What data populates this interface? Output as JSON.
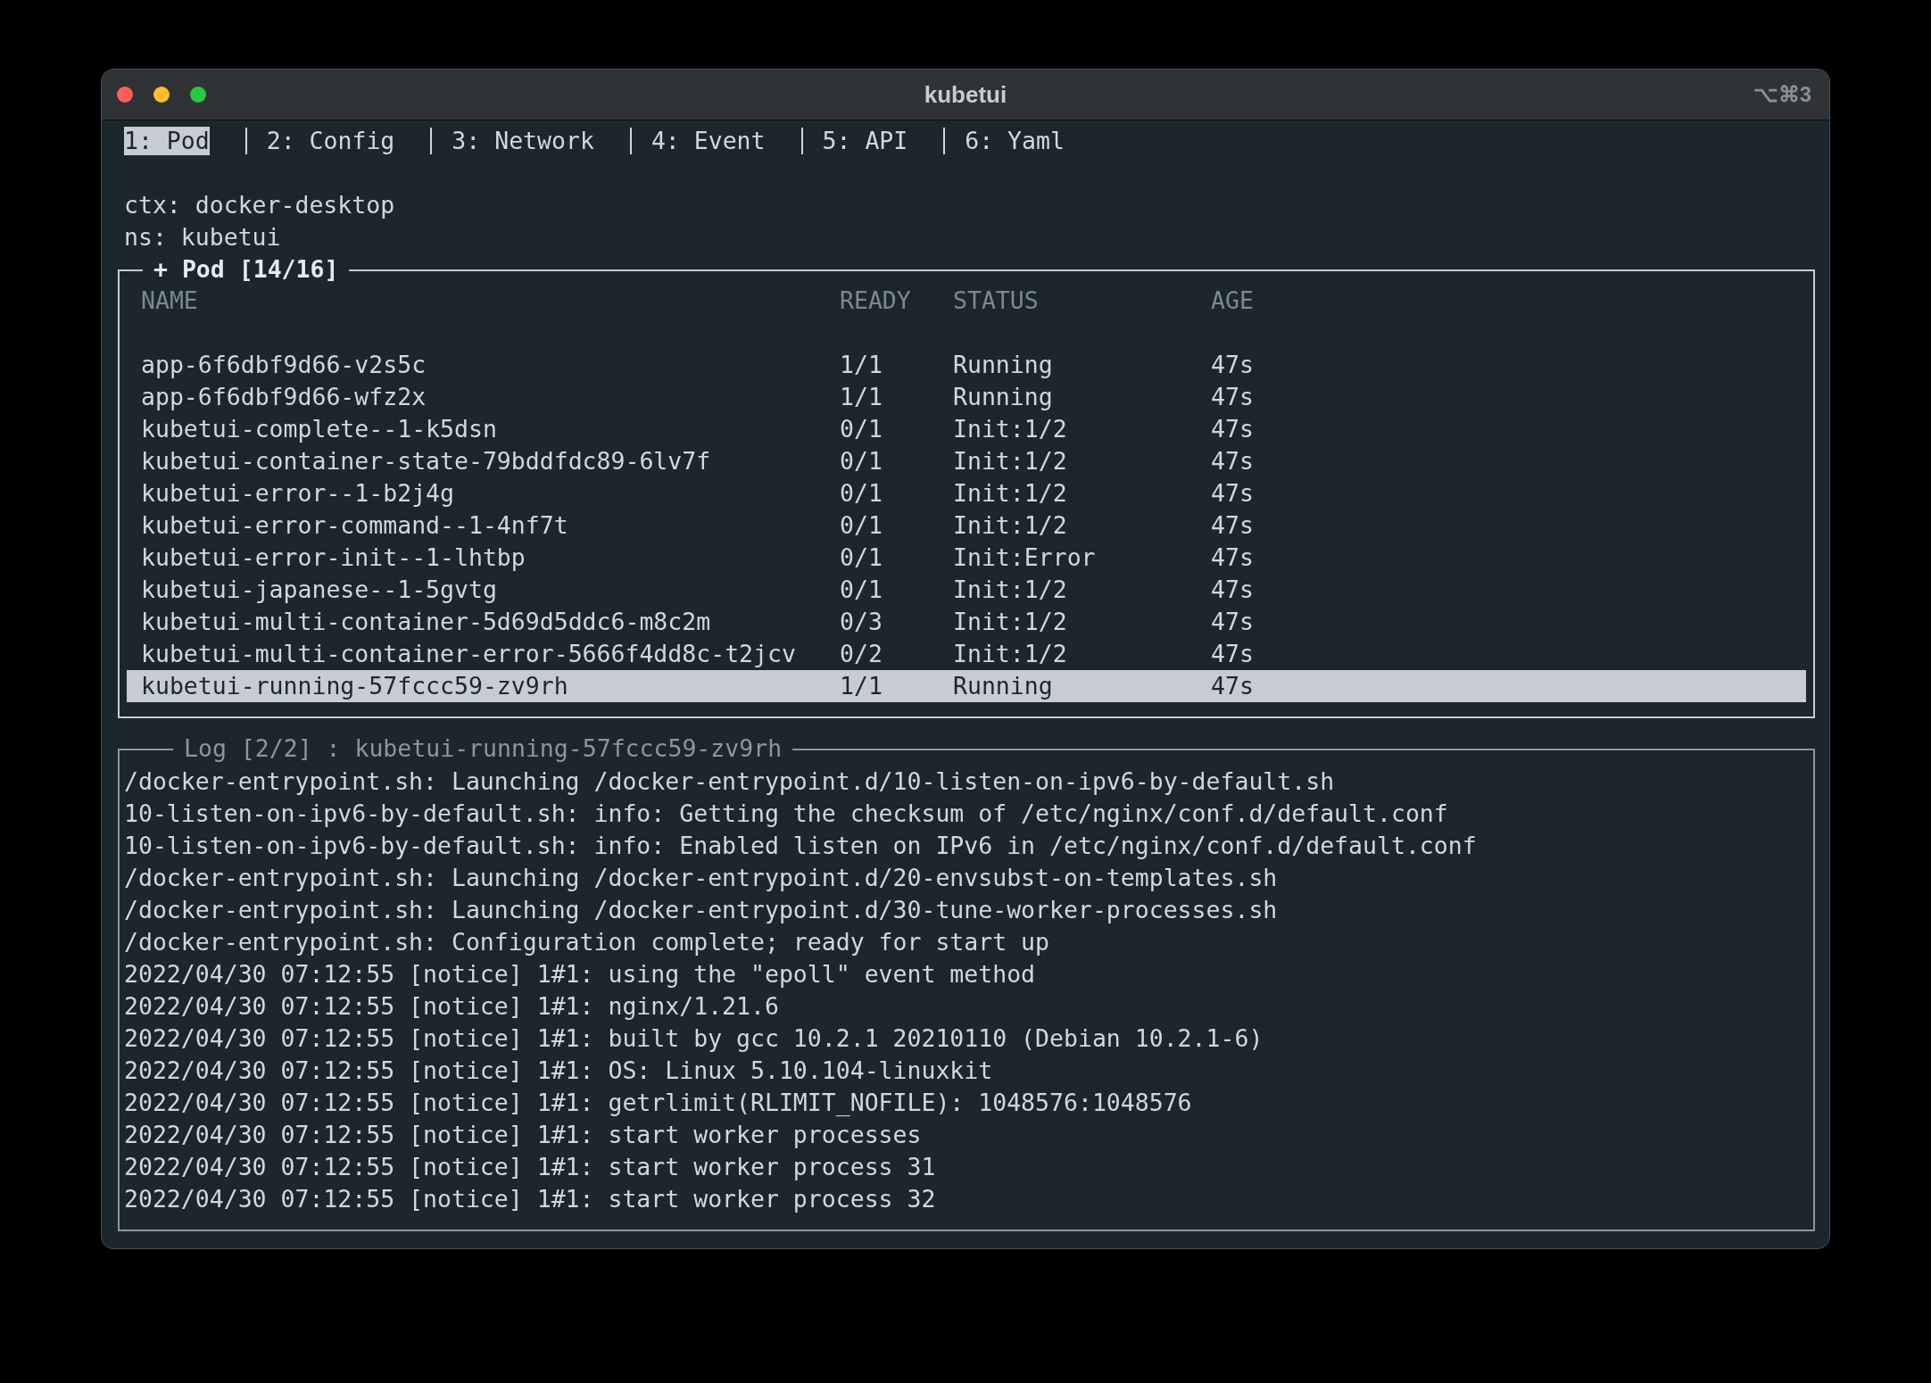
{
  "window": {
    "title": "kubetui",
    "shortcut": "⌥⌘3"
  },
  "tabs": [
    {
      "label": "1: Pod",
      "selected": true
    },
    {
      "label": "2: Config",
      "selected": false
    },
    {
      "label": "3: Network",
      "selected": false
    },
    {
      "label": "4: Event",
      "selected": false
    },
    {
      "label": "5: API",
      "selected": false
    },
    {
      "label": "6: Yaml",
      "selected": false
    }
  ],
  "context": "ctx: docker-desktop",
  "namespace": "ns: kubetui",
  "pod_panel": {
    "title": "+ Pod [14/16]",
    "active": true,
    "columns": [
      "NAME",
      "READY",
      "STATUS",
      "AGE"
    ],
    "rows": [
      {
        "name": "app-6f6dbf9d66-v2s5c",
        "ready": "1/1",
        "status": "Running",
        "age": "47s",
        "selected": false
      },
      {
        "name": "app-6f6dbf9d66-wfz2x",
        "ready": "1/1",
        "status": "Running",
        "age": "47s",
        "selected": false
      },
      {
        "name": "kubetui-complete--1-k5dsn",
        "ready": "0/1",
        "status": "Init:1/2",
        "age": "47s",
        "selected": false
      },
      {
        "name": "kubetui-container-state-79bddfdc89-6lv7f",
        "ready": "0/1",
        "status": "Init:1/2",
        "age": "47s",
        "selected": false
      },
      {
        "name": "kubetui-error--1-b2j4g",
        "ready": "0/1",
        "status": "Init:1/2",
        "age": "47s",
        "selected": false
      },
      {
        "name": "kubetui-error-command--1-4nf7t",
        "ready": "0/1",
        "status": "Init:1/2",
        "age": "47s",
        "selected": false
      },
      {
        "name": "kubetui-error-init--1-lhtbp",
        "ready": "0/1",
        "status": "Init:Error",
        "age": "47s",
        "selected": false
      },
      {
        "name": "kubetui-japanese--1-5gvtg",
        "ready": "0/1",
        "status": "Init:1/2",
        "age": "47s",
        "selected": false
      },
      {
        "name": "kubetui-multi-container-5d69d5ddc6-m8c2m",
        "ready": "0/3",
        "status": "Init:1/2",
        "age": "47s",
        "selected": false
      },
      {
        "name": "kubetui-multi-container-error-5666f4dd8c-t2jcv",
        "ready": "0/2",
        "status": "Init:1/2",
        "age": "47s",
        "selected": false
      },
      {
        "name": "kubetui-running-57fccc59-zv9rh",
        "ready": "1/1",
        "status": "Running",
        "age": "47s",
        "selected": true
      }
    ]
  },
  "log_panel": {
    "title": "Log [2/2] : kubetui-running-57fccc59-zv9rh",
    "active": false,
    "lines": [
      "/docker-entrypoint.sh: Launching /docker-entrypoint.d/10-listen-on-ipv6-by-default.sh",
      "10-listen-on-ipv6-by-default.sh: info: Getting the checksum of /etc/nginx/conf.d/default.conf",
      "10-listen-on-ipv6-by-default.sh: info: Enabled listen on IPv6 in /etc/nginx/conf.d/default.conf",
      "/docker-entrypoint.sh: Launching /docker-entrypoint.d/20-envsubst-on-templates.sh",
      "/docker-entrypoint.sh: Launching /docker-entrypoint.d/30-tune-worker-processes.sh",
      "/docker-entrypoint.sh: Configuration complete; ready for start up",
      "2022/04/30 07:12:55 [notice] 1#1: using the \"epoll\" event method",
      "2022/04/30 07:12:55 [notice] 1#1: nginx/1.21.6",
      "2022/04/30 07:12:55 [notice] 1#1: built by gcc 10.2.1 20210110 (Debian 10.2.1-6)",
      "2022/04/30 07:12:55 [notice] 1#1: OS: Linux 5.10.104-linuxkit",
      "2022/04/30 07:12:55 [notice] 1#1: getrlimit(RLIMIT_NOFILE): 1048576:1048576",
      "2022/04/30 07:12:55 [notice] 1#1: start worker processes",
      "2022/04/30 07:12:55 [notice] 1#1: start worker process 31",
      "2022/04/30 07:12:55 [notice] 1#1: start worker process 32"
    ]
  }
}
